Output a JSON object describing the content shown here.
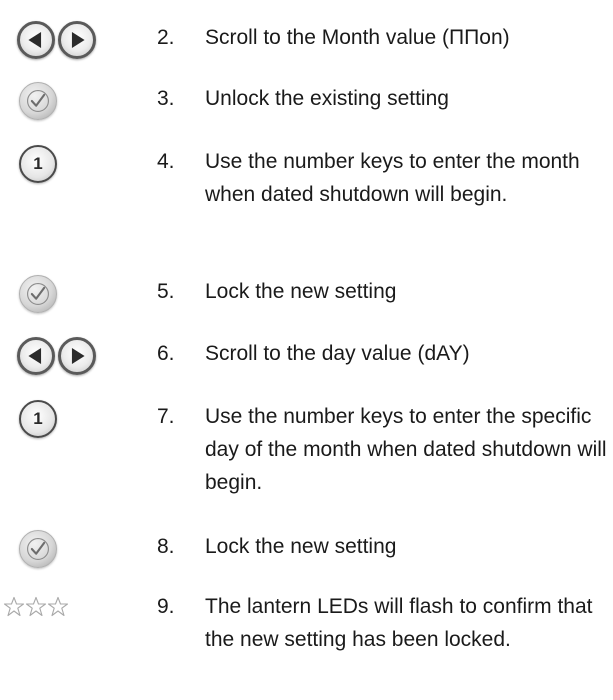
{
  "icons": {
    "left": "left-arrow-icon",
    "right": "right-arrow-icon",
    "check": "check-icon",
    "one": "number-one-icon",
    "stars": "stars-icon"
  },
  "colors": {
    "text": "#1a1a1a",
    "button_border": "#5a5a5a",
    "check_gray": "#a6a6a6",
    "star_outline": "#a9a9a9"
  },
  "steps": [
    {
      "number": "2.",
      "text": "Scroll to the Month value (ΠΠon)",
      "icon": "arrows"
    },
    {
      "number": "3.",
      "text": "Unlock the existing setting",
      "icon": "check"
    },
    {
      "number": "4.",
      "text": "Use the number keys to enter the month when dated shutdown will begin.",
      "icon": "one",
      "one_label": "1"
    },
    {
      "number": "5.",
      "text": "Lock the new setting",
      "icon": "check"
    },
    {
      "number": "6.",
      "text": "Scroll to the day value (dAY)",
      "icon": "arrows"
    },
    {
      "number": "7.",
      "text": "Use the number keys to enter the specific day of the month when dated shutdown will begin.",
      "icon": "one",
      "one_label": "1"
    },
    {
      "number": "8.",
      "text": "Lock the new setting",
      "icon": "check"
    },
    {
      "number": "9.",
      "text": "The lantern LEDs will flash to confirm that the new setting has been locked.",
      "icon": "stars"
    }
  ]
}
